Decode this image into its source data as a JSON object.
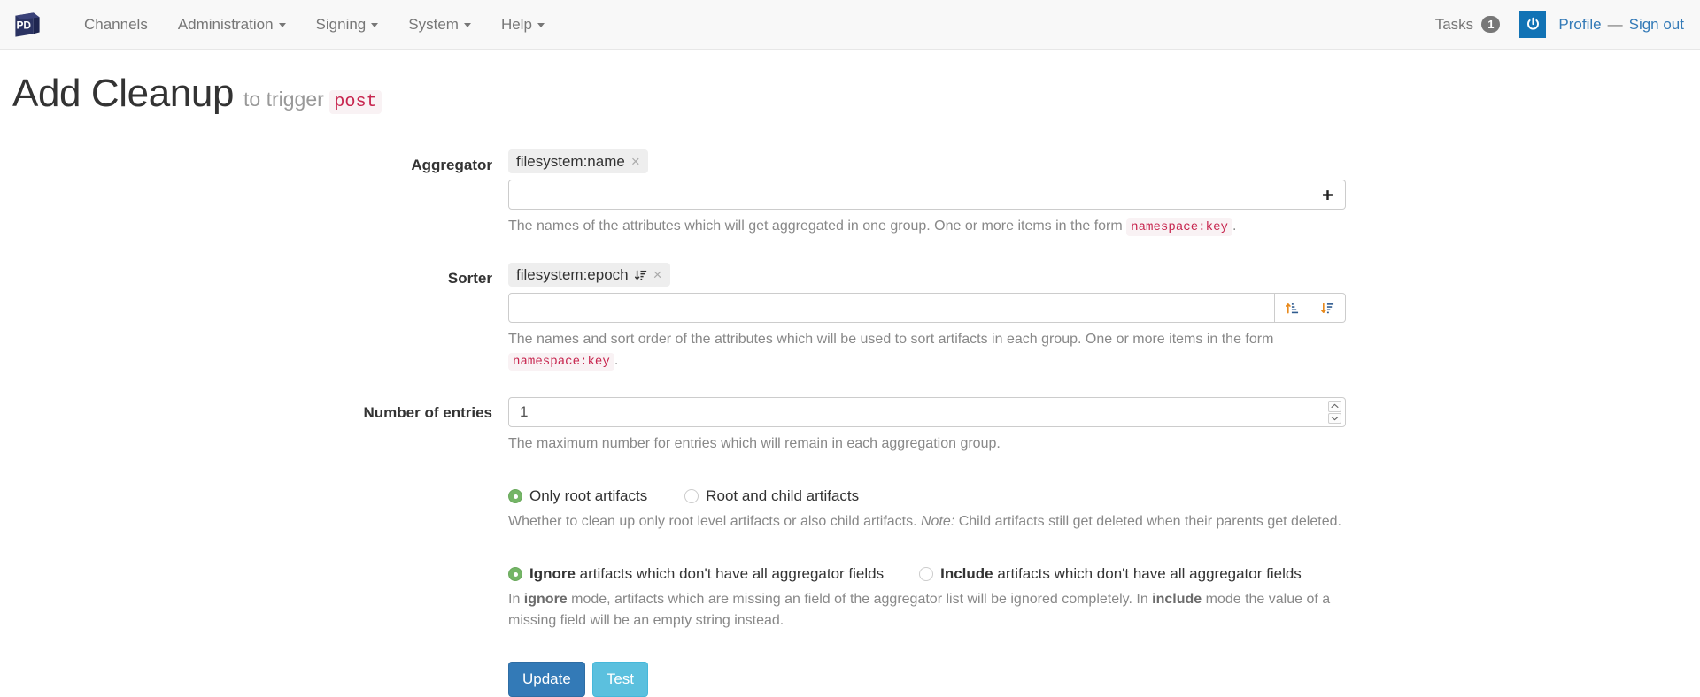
{
  "navbar": {
    "brand_text": "PD",
    "brand_icon": "pd-cube-logo",
    "items": [
      {
        "label": "Channels",
        "caret": false
      },
      {
        "label": "Administration",
        "caret": true
      },
      {
        "label": "Signing",
        "caret": true
      },
      {
        "label": "System",
        "caret": true
      },
      {
        "label": "Help",
        "caret": true
      }
    ],
    "tasks_label": "Tasks",
    "tasks_count": "1",
    "power_icon": "power-icon",
    "profile_label": "Profile",
    "separator": "—",
    "signout_label": "Sign out",
    "accent_blue": "#1273b5",
    "link_blue": "#337ab7"
  },
  "page": {
    "title": "Add Cleanup",
    "subtitle": "to trigger",
    "trigger_code": "post"
  },
  "form": {
    "aggregator": {
      "label": "Aggregator",
      "tags": [
        {
          "text": "filesystem:name",
          "remove": "×"
        }
      ],
      "input_value": "",
      "input_placeholder": "",
      "add_icon": "plus-icon",
      "help_pre": "The names of the attributes which will get aggregated in one group. One or more items in the form ",
      "help_code": "namespace:key",
      "help_post": "."
    },
    "sorter": {
      "label": "Sorter",
      "tags": [
        {
          "text": "filesystem:epoch",
          "sort_icon": "sort-amount-desc-icon",
          "remove": "×"
        }
      ],
      "input_value": "",
      "input_placeholder": "",
      "asc_icon": "sort-amount-asc-icon",
      "desc_icon": "sort-amount-desc-icon",
      "help_pre": "The names and sort order of the attributes which will be used to sort artifacts in each group. One or more items in the form ",
      "help_code": "namespace:key",
      "help_post": "."
    },
    "number_of_entries": {
      "label": "Number of entries",
      "value": "1",
      "spinner_up": "chevron-up-icon",
      "spinner_down": "chevron-down-icon",
      "help": "The maximum number for entries which will remain in each aggregation group."
    },
    "scope": {
      "option_1": "Only root artifacts",
      "option_2": "Root and child artifacts",
      "selected": "option_1",
      "help_pre": "Whether to clean up only root level artifacts or also child artifacts. ",
      "help_note": "Note:",
      "help_post": " Child artifacts still get deleted when their parents get deleted."
    },
    "missing_fields": {
      "option_1_strong": "Ignore",
      "option_1_rest": " artifacts which don't have all aggregator fields",
      "option_2_strong": "Include",
      "option_2_rest": " artifacts which don't have all aggregator fields",
      "selected": "option_1",
      "help_a": "In ",
      "help_b": "ignore",
      "help_c": " mode, artifacts which are missing an field of the aggregator list will be ignored completely. In ",
      "help_d": "include",
      "help_e": " mode the value of a missing field will be an empty string instead."
    },
    "actions": {
      "update_label": "Update",
      "test_label": "Test"
    }
  },
  "colors": {
    "radio_green": "#74b566",
    "code_pink": "#c7254e",
    "code_bg": "#f9f2f4",
    "btn_primary": "#337ab7",
    "btn_info": "#5bc0de"
  }
}
